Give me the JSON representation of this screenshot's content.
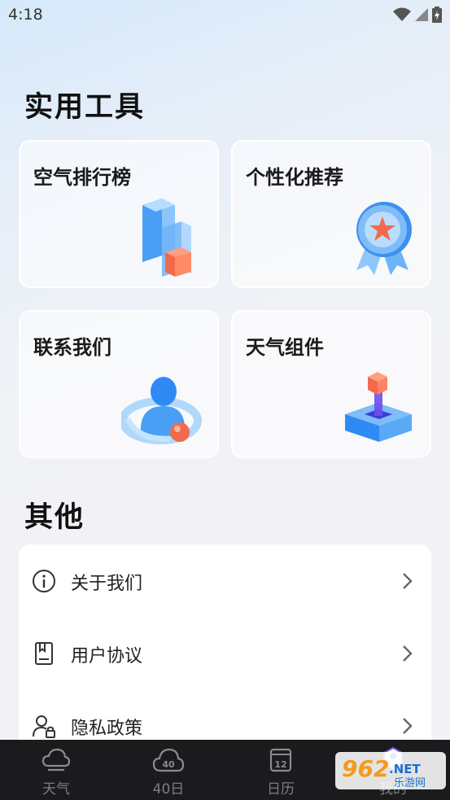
{
  "status_bar": {
    "time": "4:18"
  },
  "tools_section": {
    "title": "实用工具",
    "cards": [
      {
        "label": "空气排行榜"
      },
      {
        "label": "个性化推荐"
      },
      {
        "label": "联系我们"
      },
      {
        "label": "天气组件"
      }
    ]
  },
  "other_section": {
    "title": "其他",
    "items": [
      {
        "label": "关于我们",
        "icon": "info-icon"
      },
      {
        "label": "用户协议",
        "icon": "document-icon"
      },
      {
        "label": "隐私政策",
        "icon": "user-lock-icon"
      }
    ]
  },
  "tab_bar": {
    "tabs": [
      {
        "label": "天气",
        "icon": "cloud-icon"
      },
      {
        "label": "40日",
        "icon": "cloud-40-icon",
        "icon_text": "40"
      },
      {
        "label": "日历",
        "icon": "calendar-icon",
        "icon_text": "12"
      },
      {
        "label": "我的",
        "icon": "profile-icon"
      }
    ]
  },
  "watermark": {
    "text_main": "962",
    "text_suffix": ".NET",
    "text_sub": "乐游网"
  },
  "colors": {
    "accent_blue": "#2f8af5",
    "accent_orange": "#f26a4b",
    "tab_bar_bg": "#1b1b1d"
  }
}
